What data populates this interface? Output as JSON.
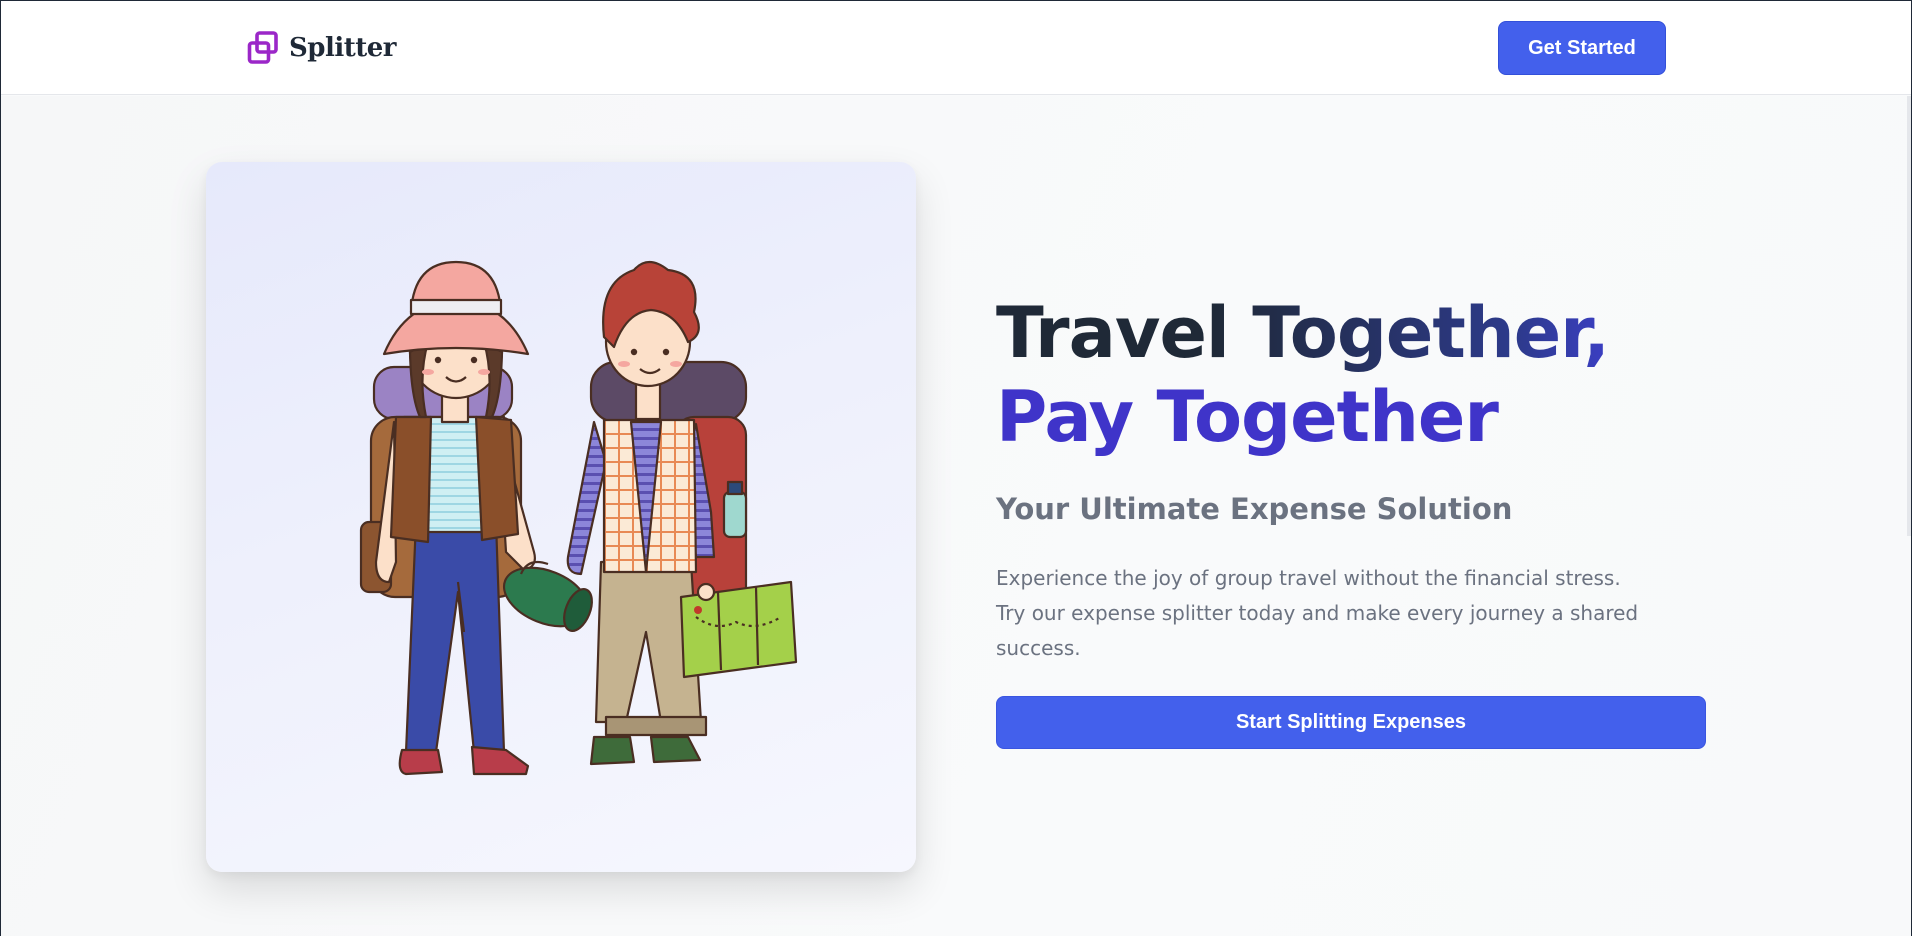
{
  "navbar": {
    "logo_text": "Splitter",
    "cta_label": "Get Started"
  },
  "hero": {
    "title_line1": "Travel Together,",
    "title_line2": "Pay Together",
    "subtitle": "Your Ultimate Expense Solution",
    "description": "Experience the joy of group travel without the financial stress. Try our expense splitter today and make every journey a shared success.",
    "cta_label": "Start Splitting Expenses",
    "illustration": "two-backpackers-illustration"
  },
  "colors": {
    "primary": "#4360ec",
    "accent_purple": "#3f34c9",
    "logo": "#9b27c8",
    "heading": "#1f2937",
    "muted": "#6b7280"
  }
}
